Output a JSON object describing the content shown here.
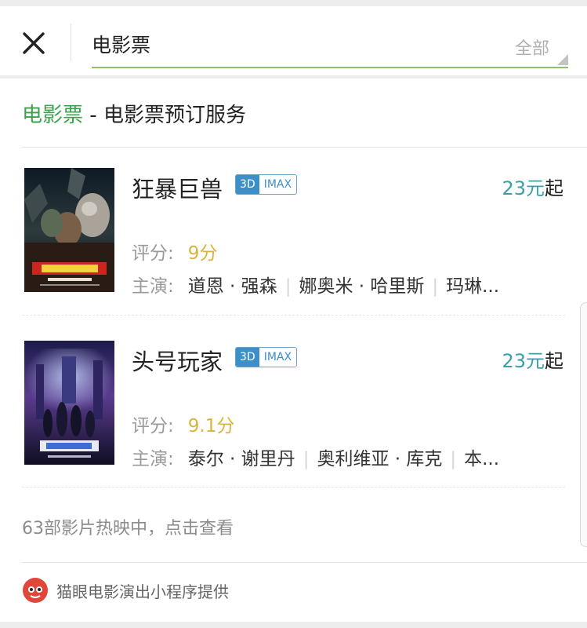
{
  "search": {
    "query": "电影票",
    "scope_label": "全部"
  },
  "service": {
    "name": "电影票",
    "separator": " - ",
    "description": "电影票预订服务"
  },
  "movies": [
    {
      "title": "狂暴巨兽",
      "tag_3d": "3D",
      "tag_imax": "IMAX",
      "price": "23元",
      "price_suffix": "起",
      "rating_label": "评分:",
      "rating": "9分",
      "cast_label": "主演:",
      "cast": [
        "道恩 · 强森",
        "娜奥米 · 哈里斯",
        "玛琳..."
      ]
    },
    {
      "title": "头号玩家",
      "tag_3d": "3D",
      "tag_imax": "IMAX",
      "price": "23元",
      "price_suffix": "起",
      "rating_label": "评分:",
      "rating": "9.1分",
      "cast_label": "主演:",
      "cast": [
        "泰尔 · 谢里丹",
        "奥利维亚 · 库克",
        "本..."
      ]
    }
  ],
  "more_link": "63部影片热映中，点击查看",
  "footer": {
    "provider": "猫眼电影演出小程序提供"
  },
  "colors": {
    "accent_green": "#3aa34a",
    "price_teal": "#3aa0a8",
    "rating_gold": "#d9b43c",
    "tag_blue": "#3d8fc7",
    "logo_red": "#e0463a"
  }
}
